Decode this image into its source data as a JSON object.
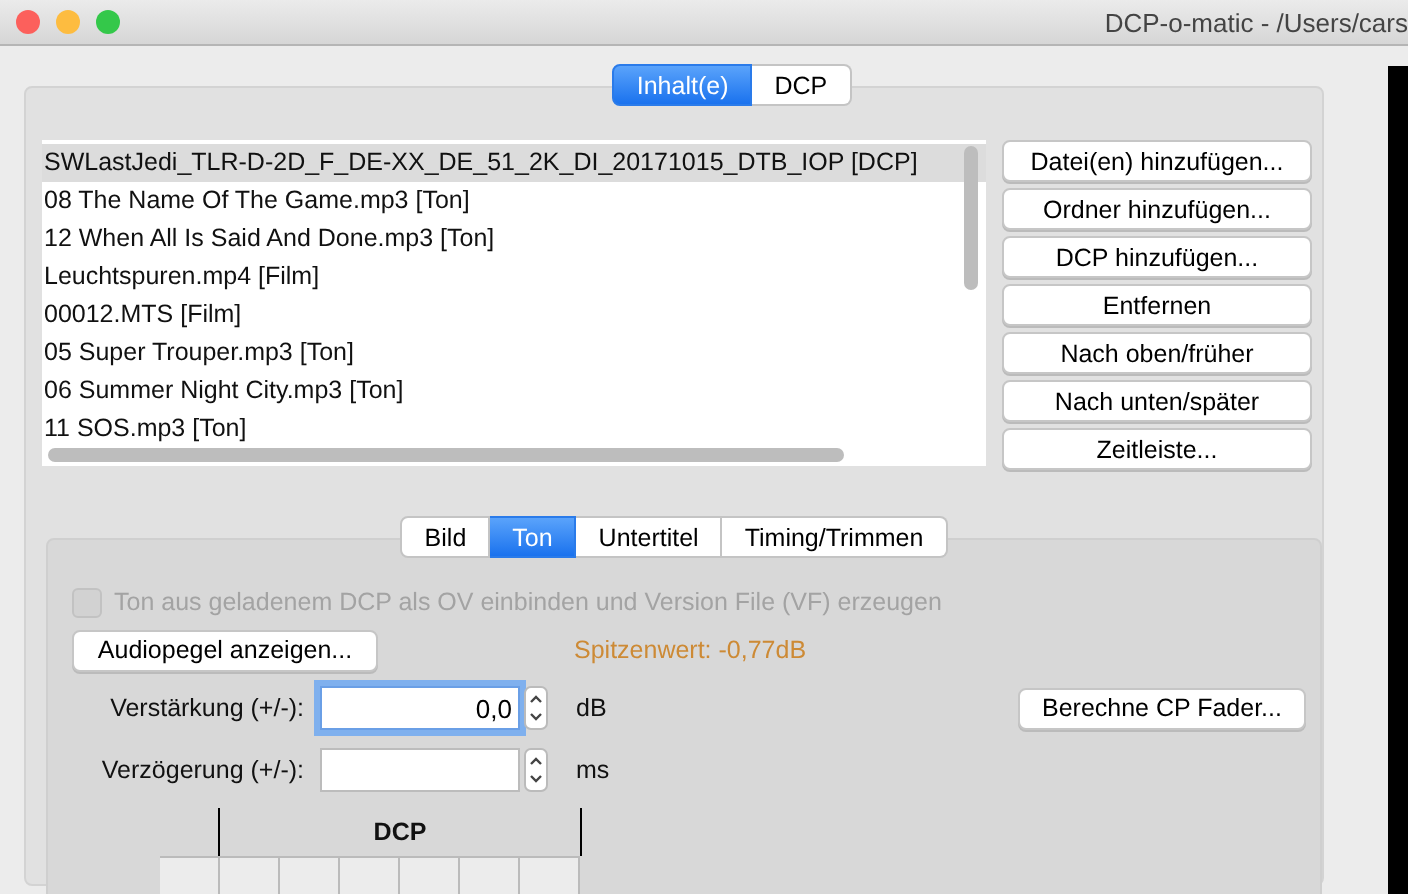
{
  "window": {
    "title": "DCP-o-matic - /Users/cars"
  },
  "tabs": [
    {
      "label": "Inhalt(e)",
      "selected": true
    },
    {
      "label": "DCP",
      "selected": false
    }
  ],
  "content_list": {
    "items": [
      {
        "label": "SWLastJedi_TLR-D-2D_F_DE-XX_DE_51_2K_DI_20171015_DTB_IOP [DCP]",
        "selected": true
      },
      {
        "label": "08 The Name Of The Game.mp3 [Ton]",
        "selected": false
      },
      {
        "label": "12 When All Is Said And Done.mp3 [Ton]",
        "selected": false
      },
      {
        "label": "Leuchtspuren.mp4 [Film]",
        "selected": false
      },
      {
        "label": "00012.MTS [Film]",
        "selected": false
      },
      {
        "label": "05 Super Trouper.mp3 [Ton]",
        "selected": false
      },
      {
        "label": "06 Summer Night City.mp3 [Ton]",
        "selected": false
      },
      {
        "label": "11 SOS.mp3 [Ton]",
        "selected": false
      }
    ]
  },
  "content_buttons": [
    "Datei(en) hinzufügen...",
    "Ordner hinzufügen...",
    "DCP hinzufügen...",
    "Entfernen",
    "Nach oben/früher",
    "Nach unten/später",
    "Zeitleiste..."
  ],
  "sub_tabs": [
    {
      "label": "Bild",
      "selected": false
    },
    {
      "label": "Ton",
      "selected": true
    },
    {
      "label": "Untertitel",
      "selected": false
    },
    {
      "label": "Timing/Trimmen",
      "selected": false
    }
  ],
  "audio": {
    "ov_checkbox": {
      "label": "Ton aus geladenem DCP als OV einbinden und Version File (VF) erzeugen",
      "checked": false,
      "disabled": true
    },
    "levels_button": "Audiopegel anzeigen...",
    "peak": "Spitzenwert: -0,77dB",
    "gain": {
      "label": "Verstärkung (+/-):",
      "value": "0,0",
      "unit": "dB",
      "focused": true
    },
    "fader_button": "Berechne CP Fader...",
    "delay": {
      "label": "Verzögerung (+/-):",
      "unit": "ms",
      "focused": false
    },
    "mapping": {
      "header": "DCP"
    }
  }
}
